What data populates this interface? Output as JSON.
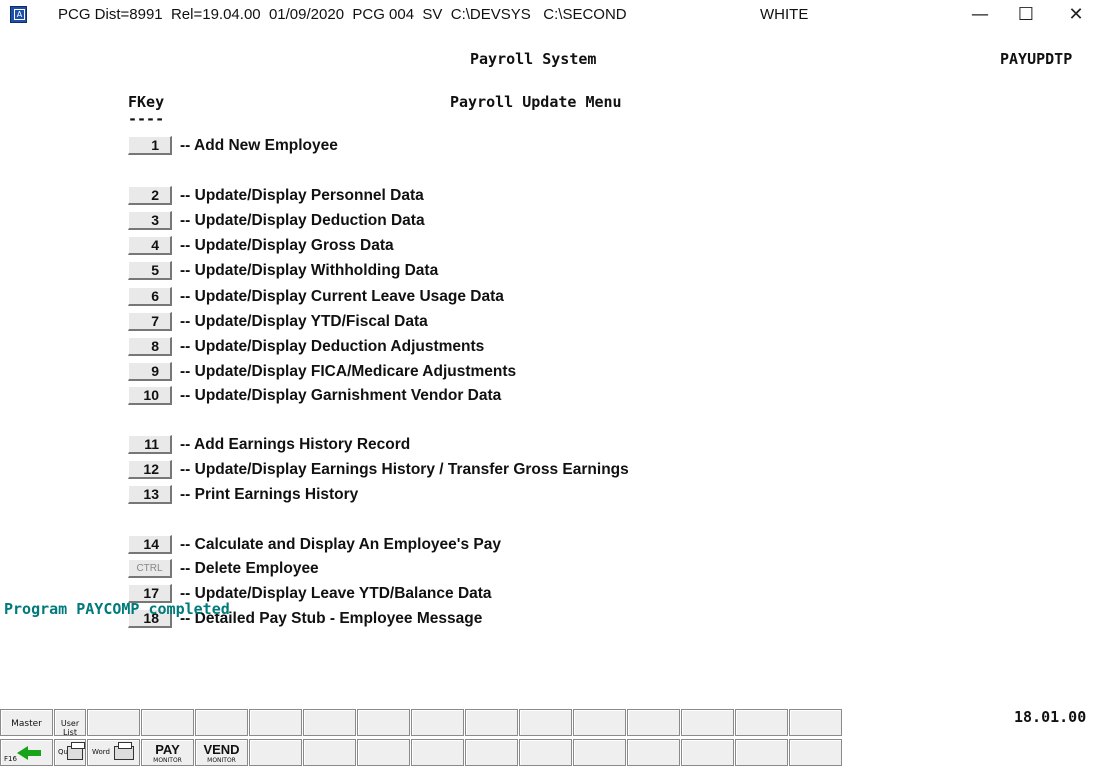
{
  "window": {
    "title": "PCG Dist=8991  Rel=19.04.00  01/09/2020  PCG 004  SV  C:\\DEVSYS   C:\\SECOND",
    "user": "WHITE",
    "icon": "terminal-app-icon",
    "controls": {
      "minimize": "—",
      "maximize": "☐",
      "close": "✕"
    }
  },
  "screen": {
    "system_title": "Payroll System",
    "screen_id": "PAYUPDTP",
    "fkey_header": "FKey",
    "fkey_underline": "----",
    "menu_title": "Payroll Update Menu"
  },
  "menu": [
    {
      "key": "1",
      "label": "-- Add New Employee"
    },
    {
      "key": "2",
      "label": "-- Update/Display Personnel Data"
    },
    {
      "key": "3",
      "label": "-- Update/Display Deduction Data"
    },
    {
      "key": "4",
      "label": "-- Update/Display Gross Data"
    },
    {
      "key": "5",
      "label": "-- Update/Display Withholding Data"
    },
    {
      "key": "6",
      "label": "-- Update/Display Current Leave Usage Data"
    },
    {
      "key": "7",
      "label": "-- Update/Display YTD/Fiscal Data"
    },
    {
      "key": "8",
      "label": "-- Update/Display Deduction Adjustments"
    },
    {
      "key": "9",
      "label": "-- Update/Display FICA/Medicare Adjustments"
    },
    {
      "key": "10",
      "label": "-- Update/Display Garnishment Vendor Data"
    },
    {
      "key": "11",
      "label": "-- Add Earnings History Record"
    },
    {
      "key": "12",
      "label": "-- Update/Display Earnings History / Transfer Gross Earnings"
    },
    {
      "key": "13",
      "label": "-- Print Earnings History"
    },
    {
      "key": "14",
      "label": "-- Calculate and Display An Employee's Pay"
    },
    {
      "key": "CTRL",
      "label": "-- Delete Employee"
    },
    {
      "key": "17",
      "label": "-- Update/Display Leave YTD/Balance Data"
    },
    {
      "key": "18",
      "label": "-- Detailed Pay Stub - Employee Message"
    }
  ],
  "status_message": "Program PAYCOMP completed",
  "clock": "18.01.00",
  "toolbar": {
    "master": "Master",
    "user_list": "User List",
    "f16": "F16",
    "word": "Word",
    "pay": "PAY",
    "pay_sub": "MONITOR",
    "vend": "VEND",
    "vend_sub": "MONITOR",
    "que": "Que"
  }
}
